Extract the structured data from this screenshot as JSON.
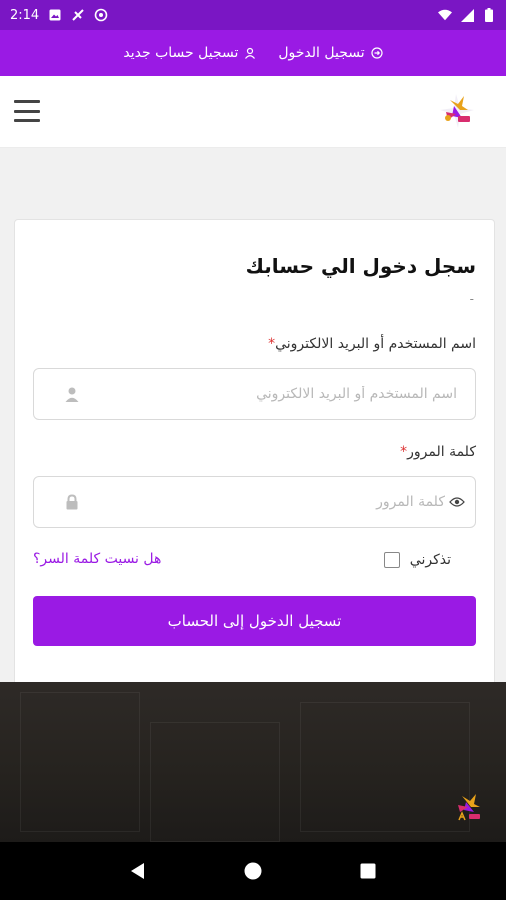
{
  "status_bar": {
    "time": "2:14"
  },
  "top_links": {
    "login": "تسجيل الدخول",
    "register": "تسجيل حساب جديد"
  },
  "login_card": {
    "title": "سجل دخول الي حسابك",
    "dash": "-",
    "username_label": "اسم المستخدم أو البريد الالكتروني",
    "username_placeholder": "اسم المستخدم أو البريد الالكتروني",
    "password_label": "كلمة المرور",
    "password_placeholder": "كلمة المرور",
    "required_mark": "*",
    "remember_label": "تذكرني",
    "forgot_link": "هل نسيت كلمة السر؟",
    "submit_label": "تسجيل الدخول إلى الحساب"
  },
  "colors": {
    "status_bar": "#7a16c4",
    "accent": "#9a1ae4"
  },
  "icons": {
    "status_left": [
      "image-icon",
      "no-signal-icon",
      "at-sign-icon"
    ],
    "status_right": [
      "wifi-icon",
      "cell-signal-icon",
      "battery-icon"
    ],
    "nav": [
      "back-icon",
      "home-icon",
      "recents-icon"
    ]
  }
}
